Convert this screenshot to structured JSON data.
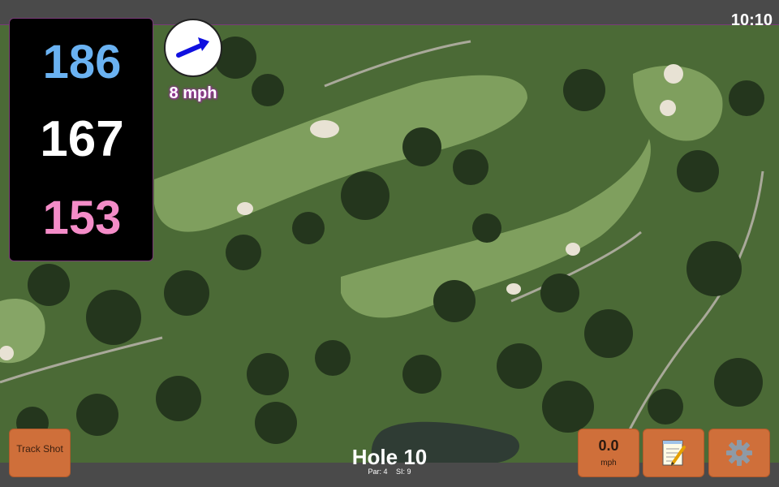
{
  "header": {
    "time": "10:10"
  },
  "distances": {
    "back": "186",
    "middle": "167",
    "front": "153"
  },
  "wind": {
    "label": "8 mph",
    "direction_icon": "arrow-up-right-icon"
  },
  "buttons": {
    "track_shot": "Track Shot",
    "wind_speed_value": "0.0",
    "wind_speed_unit": "mph",
    "notes_icon": "notepad-icon",
    "settings_icon": "gear-icon"
  },
  "hole": {
    "title": "Hole 10",
    "par": "Par: 4",
    "si": "SI: 9"
  },
  "colors": {
    "back_distance": "#6ab2f2",
    "middle_distance": "#ffffff",
    "front_distance": "#f48cc8",
    "button": "#cf6f3a",
    "accent": "#7a3a78"
  }
}
